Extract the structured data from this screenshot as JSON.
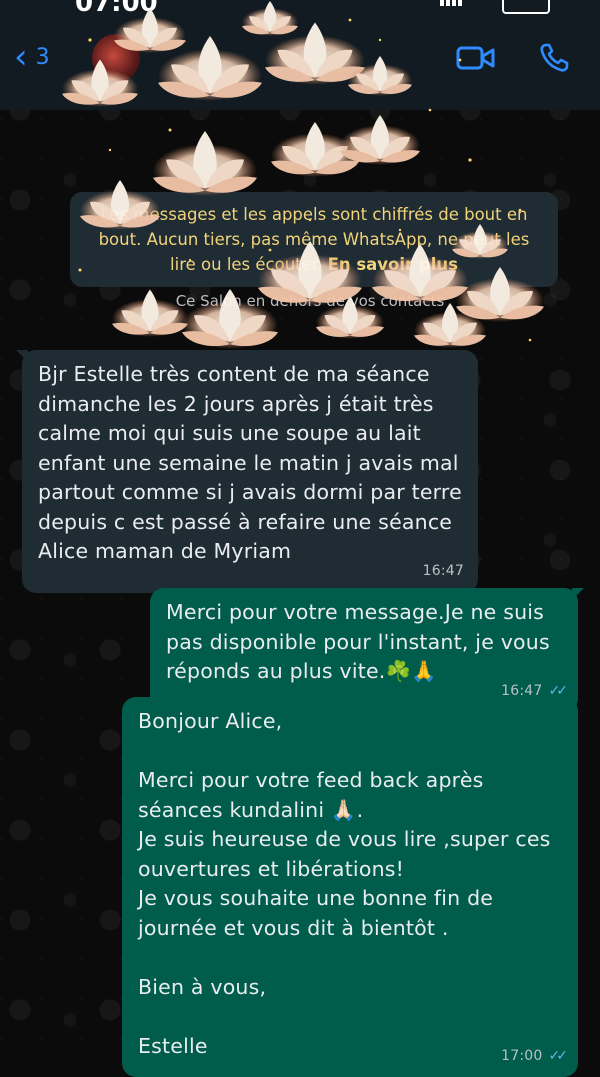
{
  "status_bar": {
    "time": "07:00"
  },
  "header": {
    "back_count": "3",
    "contact_name": "",
    "icons": {
      "back": "chevron-left-icon",
      "video": "video-camera-icon",
      "call": "phone-icon"
    },
    "accent_color": "#2f8cff"
  },
  "encryption_notice": {
    "text": "Les messages et les appels sont chiffrés de bout en bout. Aucun tiers, pas même WhatsApp, ne peut les lire ou les écouter.",
    "link": "En savoir plus"
  },
  "system_line": "Ce Salon en dehors de vos contacts",
  "messages": [
    {
      "direction": "incoming",
      "text": "Bjr Estelle très content de ma séance dimanche les 2 jours après j était très calme moi qui suis une soupe au lait enfant une semaine le matin j avais mal partout comme si j avais dormi par terre depuis c est passé à refaire une séance Alice maman de Myriam",
      "time": "16:47"
    },
    {
      "direction": "outgoing",
      "text": "Merci pour votre message.Je ne suis pas disponible pour l'instant, je vous réponds au plus vite.☘️🙏",
      "time": "16:47",
      "status": "read"
    },
    {
      "direction": "outgoing",
      "text": "Bonjour Alice,\n\nMerci pour votre feed back après séances kundalini 🙏🏻.\nJe suis heureuse de vous lire ,super ces ouvertures et libérations!\nJe vous souhaite une bonne fin de journée et vous dit à bientôt .\n\nBien à vous,\n\nEstelle",
      "time": "17:00",
      "status": "read"
    }
  ],
  "colors": {
    "background": "#0b0b0b",
    "incoming_bubble": "#202c33",
    "outgoing_bubble": "#005c4b",
    "read_ticks": "#53bdeb"
  }
}
